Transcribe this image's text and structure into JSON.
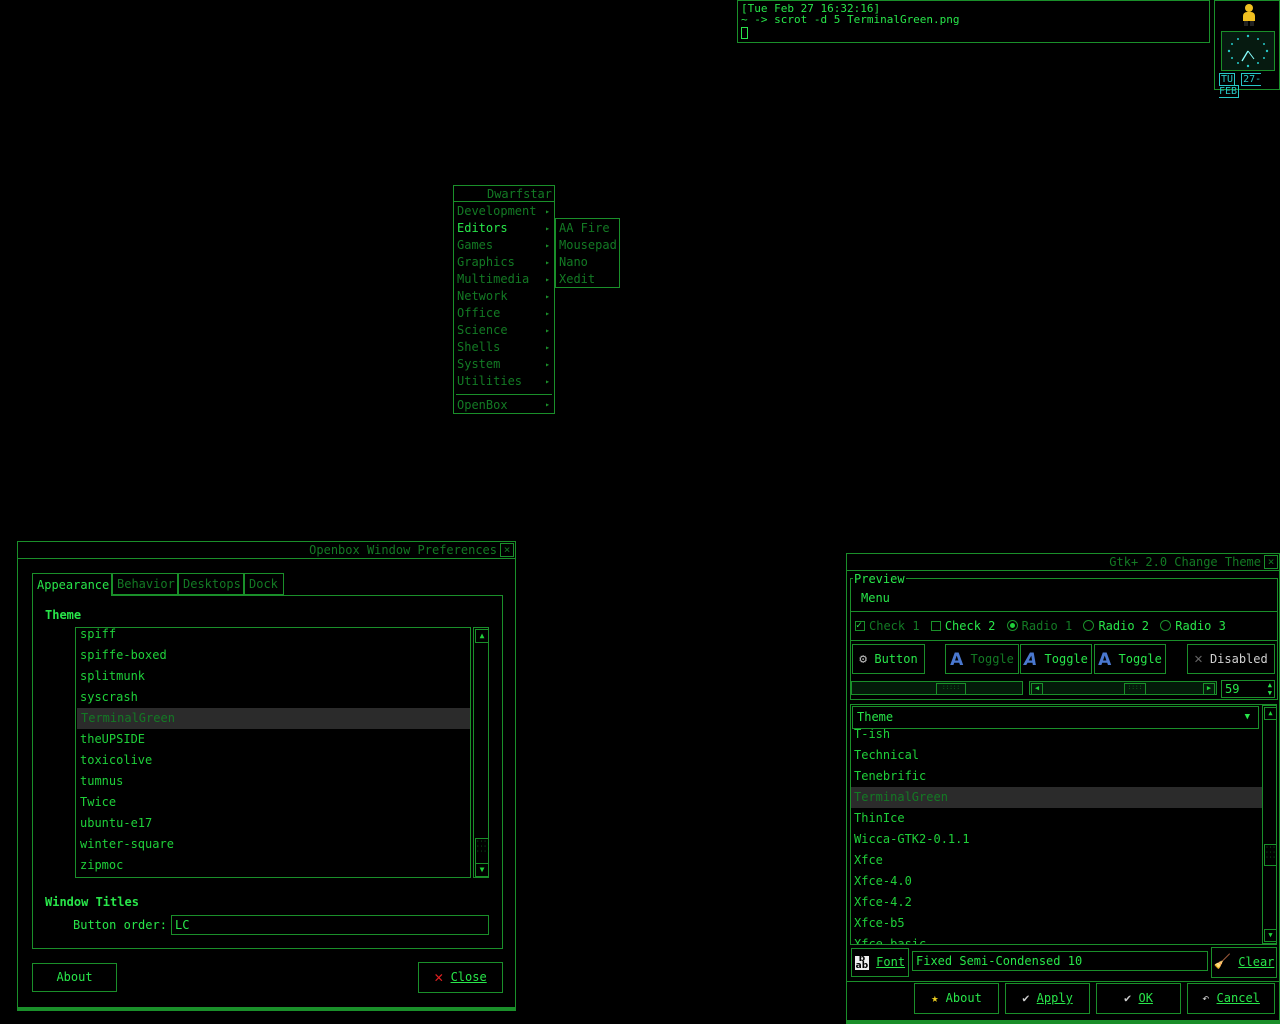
{
  "terminal": {
    "line1": "[Tue Feb 27 16:32:16]",
    "line2": "~ -> scrot -d 5 TerminalGreen.png"
  },
  "clock": {
    "day": "TU",
    "date": "27-FEB"
  },
  "menu": {
    "title": "Dwarfstar",
    "items": [
      "Development",
      "Editors",
      "Games",
      "Graphics",
      "Multimedia",
      "Network",
      "Office",
      "Science",
      "Shells",
      "System",
      "Utilities"
    ],
    "footer": "OpenBox",
    "submenu": [
      "AA Fire",
      "Mousepad",
      "Nano",
      "Xedit"
    ]
  },
  "openbox": {
    "title": "Openbox Window Preferences",
    "close_glyph": "×",
    "tabs": [
      "Appearance",
      "Behavior",
      "Desktops",
      "Dock"
    ],
    "theme_label": "Theme",
    "themes": [
      "spiff",
      "spiffe-boxed",
      "splitmunk",
      "syscrash",
      "TerminalGreen",
      "theUPSIDE",
      "toxicolive",
      "tumnus",
      "Twice",
      "ubuntu-e17",
      "winter-square",
      "zipmoc"
    ],
    "selected_theme": "TerminalGreen",
    "window_titles_label": "Window Titles",
    "button_order_label": "Button order:",
    "button_order_value": "LC",
    "about_label": "About",
    "close_label": "Close"
  },
  "gtk": {
    "title": "Gtk+ 2.0 Change Theme",
    "close_glyph": "×",
    "preview_label": "Preview",
    "menu_label": "Menu",
    "check1": "Check 1",
    "check2": "Check 2",
    "radio1": "Radio 1",
    "radio2": "Radio 2",
    "radio3": "Radio 3",
    "button_label": "Button",
    "toggle1": "Toggle",
    "toggle2": "Toggle",
    "toggle3": "Toggle",
    "disabled_label": "Disabled",
    "spin_value": "59",
    "theme_header": "Theme",
    "themes": [
      "T-ish",
      "Technical",
      "Tenebrific",
      "TerminalGreen",
      "ThinIce",
      "Wicca-GTK2-0.1.1",
      "Xfce",
      "Xfce-4.0",
      "Xfce-4.2",
      "Xfce-b5",
      "Xfce-basic"
    ],
    "selected_theme": "TerminalGreen",
    "font_label": "Font",
    "font_value": "Fixed Semi-Condensed 10",
    "clear_label": "Clear",
    "about_label": "About",
    "apply_label": "Apply",
    "ok_label": "OK",
    "cancel_label": "Cancel"
  }
}
